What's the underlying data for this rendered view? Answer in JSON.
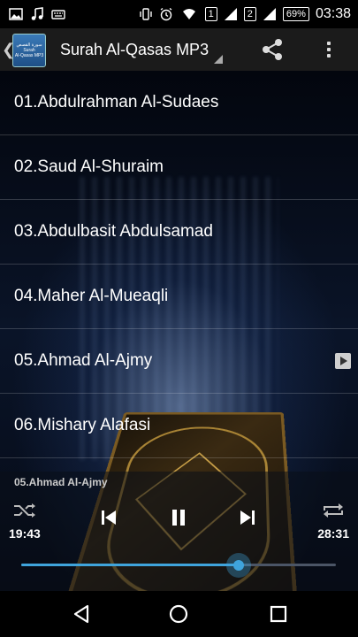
{
  "status_bar": {
    "sim1": "1",
    "sim2": "2",
    "battery": "69%",
    "time": "03:38",
    "icons": [
      "image-icon",
      "music-note-icon",
      "keyboard-icon",
      "vibrate-icon",
      "alarm-icon",
      "wifi-icon",
      "signal-icon",
      "signal-icon",
      "battery-icon"
    ]
  },
  "app_bar": {
    "icon_text_line1": "سورة القصص",
    "icon_text_line2": "Surah",
    "icon_text_line3": "Al-Qasas MP3",
    "title": "Surah Al-Qasas MP3",
    "actions": [
      "share-icon",
      "overflow-menu-icon"
    ]
  },
  "list": {
    "items": [
      {
        "label": "01.Abdulrahman Al-Sudaes"
      },
      {
        "label": "02.Saud Al-Shuraim"
      },
      {
        "label": "03.Abdulbasit Abdulsamad"
      },
      {
        "label": "04.Maher Al-Mueaqli"
      },
      {
        "label": "05.Ahmad Al-Ajmy",
        "playing": true
      },
      {
        "label": "06.Mishary Alafasi"
      }
    ]
  },
  "player": {
    "now_playing": "05.Ahmad Al-Ajmy",
    "elapsed": "19:43",
    "duration": "28:31",
    "progress": 0.69,
    "controls": [
      "shuffle-icon",
      "previous-icon",
      "pause-icon",
      "next-icon",
      "repeat-icon"
    ]
  },
  "colors": {
    "accent": "#3fa4dc",
    "app_bar_bg": "#1b1b1b",
    "status_bar_bg": "#000000"
  }
}
